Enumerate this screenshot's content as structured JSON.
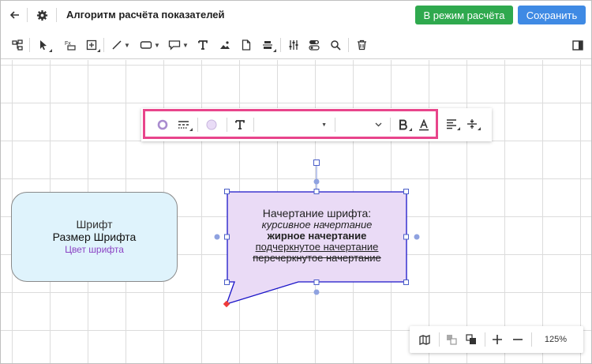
{
  "header": {
    "title": "Алгоритм расчёта показателей",
    "calc_mode_label": "В режим расчёта",
    "save_label": "Сохранить"
  },
  "format_toolbar": {
    "fill_color": "#e9dcf6",
    "accent_color": "#e8458b"
  },
  "left_shape": {
    "line1": "Шрифт",
    "line2": "Размер Шрифта",
    "line3": "Цвет шрифта",
    "fill": "#dff3fc",
    "line3_color": "#8c44c4"
  },
  "bubble": {
    "title": "Начертание шрифта:",
    "italic": "курсивное начертание",
    "bold": "жирное начертание",
    "underline": "подчеркнутое начертание",
    "strike": "перечеркнутое начертание",
    "fill": "#eadbf6",
    "border": "#1a14c8"
  },
  "zoom": {
    "level": "125%"
  }
}
